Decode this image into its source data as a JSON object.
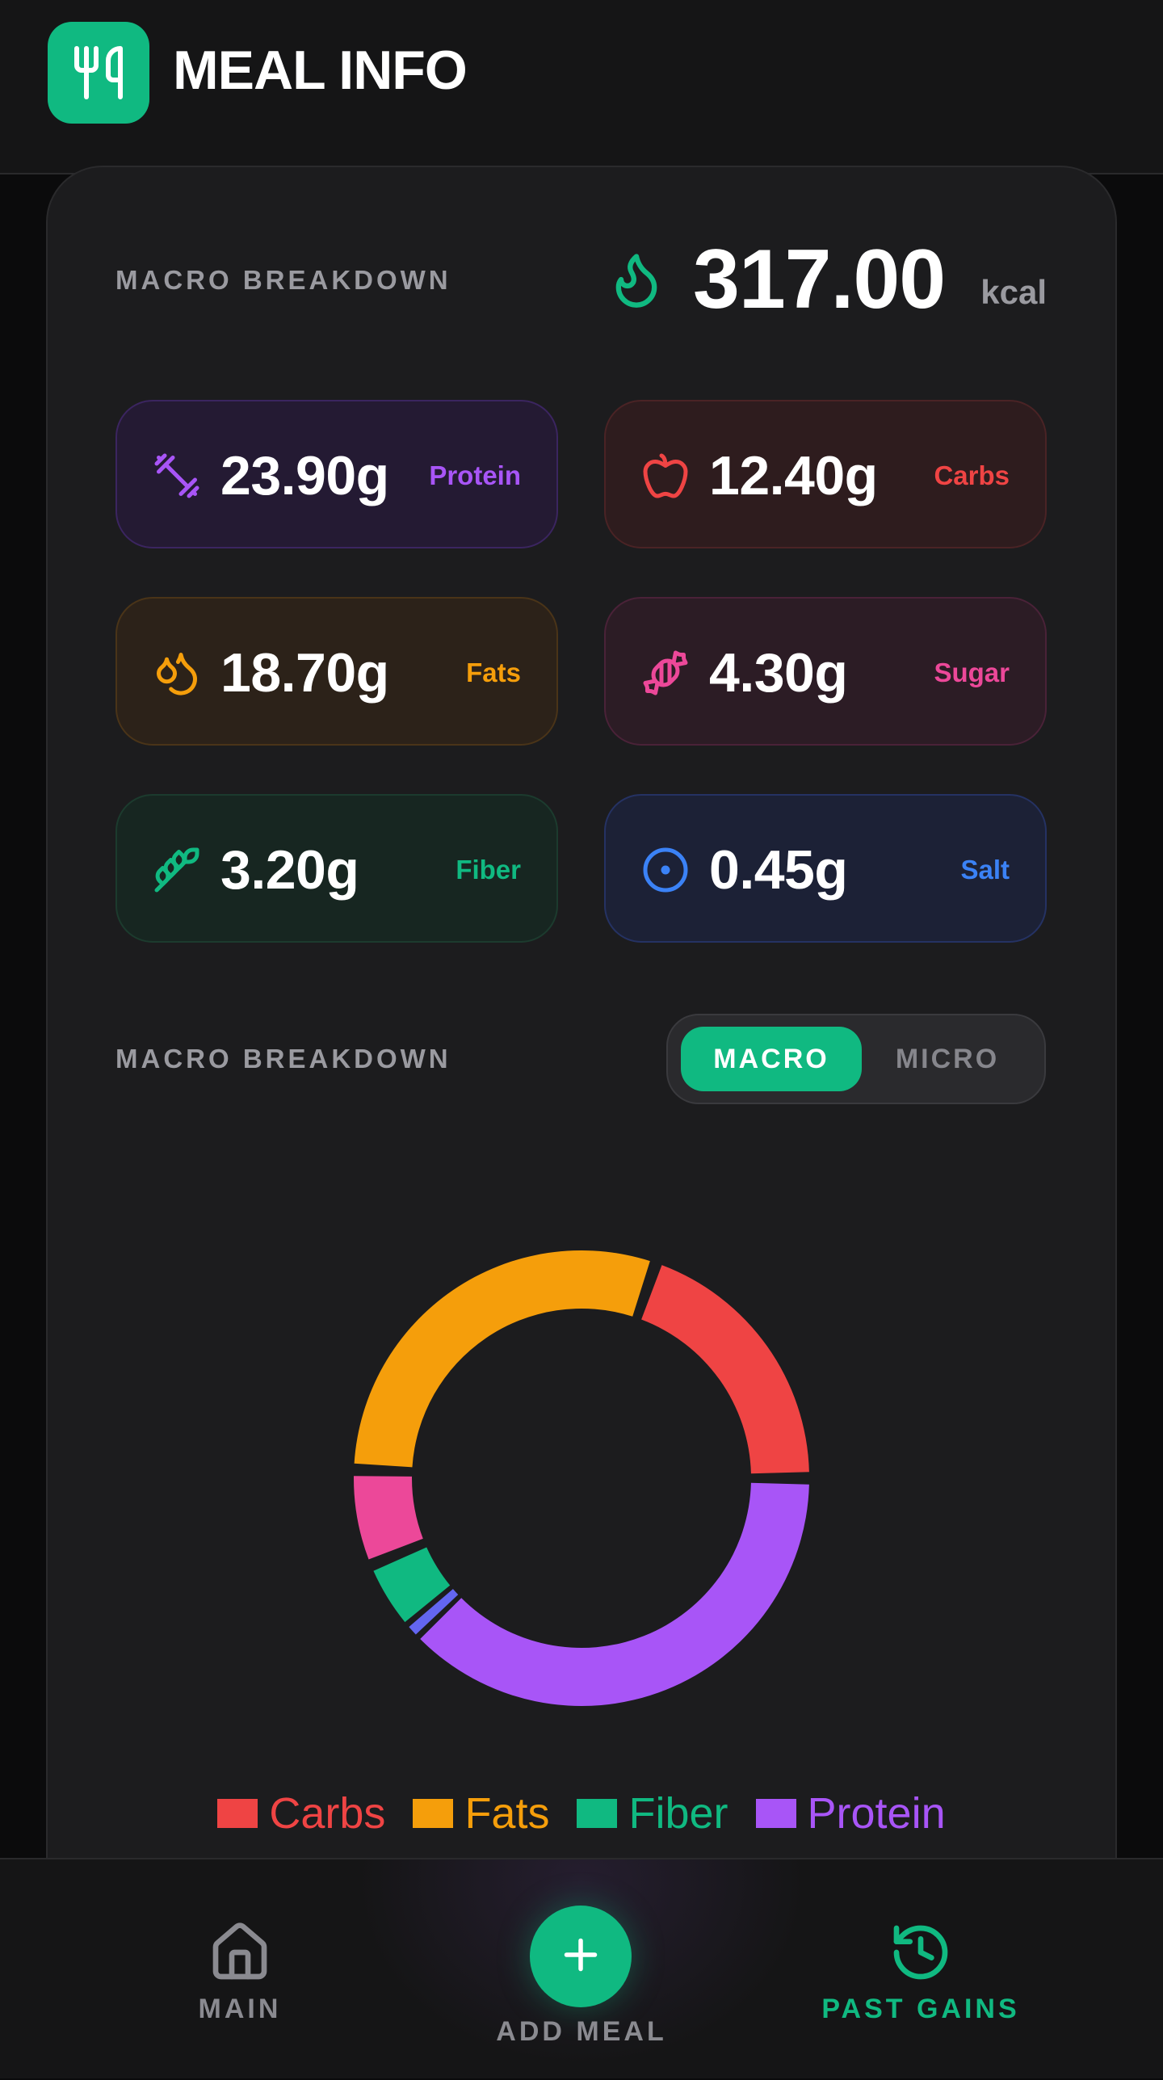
{
  "header": {
    "title": "MEAL INFO",
    "icon": "utensils-icon"
  },
  "summary": {
    "section_label": "MACRO BREAKDOWN",
    "kcal_value": "317.00",
    "kcal_unit": "kcal",
    "kcal_icon": "flame-icon"
  },
  "macros": [
    {
      "id": "protein",
      "value": "23.90g",
      "label": "Protein",
      "icon": "dumbbell-icon",
      "color": "#a855f7",
      "bg": "#241a33",
      "border": "#3b2560"
    },
    {
      "id": "carbs",
      "value": "12.40g",
      "label": "Carbs",
      "icon": "apple-icon",
      "color": "#ef4444",
      "bg": "#2e1c1e",
      "border": "#4a2325"
    },
    {
      "id": "fats",
      "value": "18.70g",
      "label": "Fats",
      "icon": "droplets-icon",
      "color": "#f59e0b",
      "bg": "#2c2219",
      "border": "#4a3418"
    },
    {
      "id": "sugar",
      "value": "4.30g",
      "label": "Sugar",
      "icon": "candy-icon",
      "color": "#ec4899",
      "bg": "#2c1c25",
      "border": "#4a2238"
    },
    {
      "id": "fiber",
      "value": "3.20g",
      "label": "Fiber",
      "icon": "wheat-icon",
      "color": "#10b981",
      "bg": "#172621",
      "border": "#1c3b2e"
    },
    {
      "id": "salt",
      "value": "0.45g",
      "label": "Salt",
      "icon": "circle-dot-icon",
      "color": "#3b82f6",
      "bg": "#1c2136",
      "border": "#253263"
    }
  ],
  "breakdown": {
    "section_label": "MACRO BREAKDOWN",
    "toggle": {
      "active": "MACRO",
      "inactive": "MICRO"
    }
  },
  "chart_data": {
    "type": "pie",
    "variant": "donut",
    "slices": [
      {
        "name": "Protein",
        "value": 23.9,
        "color": "#a855f7"
      },
      {
        "name": "Salt",
        "value": 0.45,
        "color": "#6366f1"
      },
      {
        "name": "Fiber",
        "value": 3.2,
        "color": "#10b981"
      },
      {
        "name": "Sugar",
        "value": 4.3,
        "color": "#ec4899"
      },
      {
        "name": "Fats",
        "value": 18.7,
        "color": "#f59e0b"
      },
      {
        "name": "Carbs",
        "value": 12.4,
        "color": "#ef4444"
      }
    ],
    "legend": [
      {
        "label": "Carbs",
        "color": "#ef4444"
      },
      {
        "label": "Fats",
        "color": "#f59e0b"
      },
      {
        "label": "Fiber",
        "color": "#10b981"
      },
      {
        "label": "Protein",
        "color": "#a855f7"
      }
    ],
    "legend_position": "bottom"
  },
  "nav": {
    "main": {
      "label": "MAIN",
      "icon": "home-icon"
    },
    "add": {
      "label": "ADD MEAL",
      "icon": "plus-icon"
    },
    "past": {
      "label": "PAST GAINS",
      "icon": "history-icon"
    },
    "accent": "#10b981",
    "muted": "#8a8a90"
  }
}
